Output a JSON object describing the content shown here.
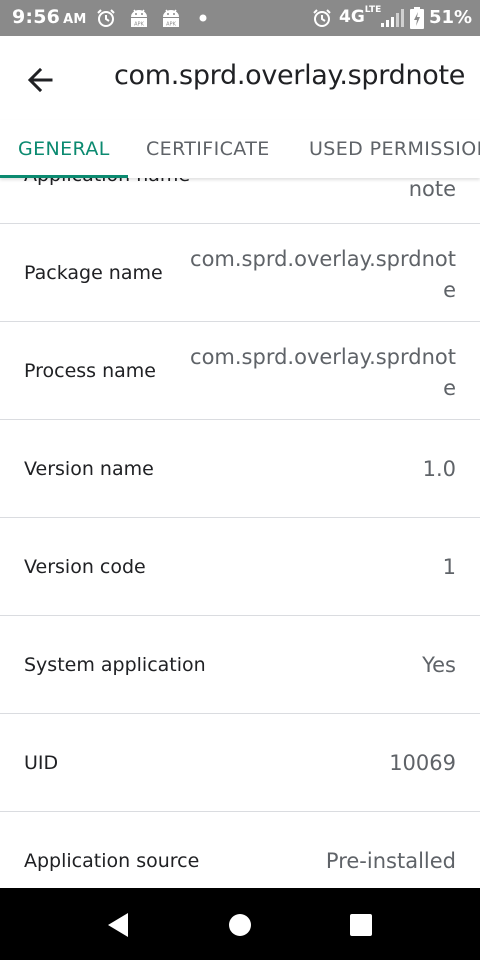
{
  "status_bar": {
    "time": "9:56",
    "ampm": "AM",
    "network": "4G",
    "network_sub": "LTE",
    "battery": "51%",
    "icons": [
      "alarm-icon",
      "apk-android-icon",
      "apk-android-icon",
      "dot-icon",
      "alarm-icon",
      "signal-icon",
      "battery-icon"
    ]
  },
  "app_bar": {
    "title": "com.sprd.overlay.sprdnote",
    "back_icon": "arrow-left-icon"
  },
  "tabs": [
    {
      "label": "GENERAL",
      "active": true
    },
    {
      "label": "CERTIFICATE",
      "active": false
    },
    {
      "label": "USED PERMISSIONS",
      "active": false
    }
  ],
  "accent_color": "#0b8a70",
  "rows": [
    {
      "label": "Application name",
      "value_lines": [
        "note"
      ]
    },
    {
      "label": "Package name",
      "value_lines": [
        "com.sprd.overlay.sprdnot",
        "e"
      ]
    },
    {
      "label": "Process name",
      "value_lines": [
        "com.sprd.overlay.sprdnot",
        "e"
      ]
    },
    {
      "label": "Version name",
      "value_lines": [
        "1.0"
      ]
    },
    {
      "label": "Version code",
      "value_lines": [
        "1"
      ]
    },
    {
      "label": "System application",
      "value_lines": [
        "Yes"
      ]
    },
    {
      "label": "UID",
      "value_lines": [
        "10069"
      ]
    },
    {
      "label": "Application source",
      "value_lines": [
        "Pre-installed"
      ]
    }
  ],
  "nav_bar": {
    "icons": [
      "back-triangle-icon",
      "home-circle-icon",
      "recents-square-icon"
    ]
  }
}
